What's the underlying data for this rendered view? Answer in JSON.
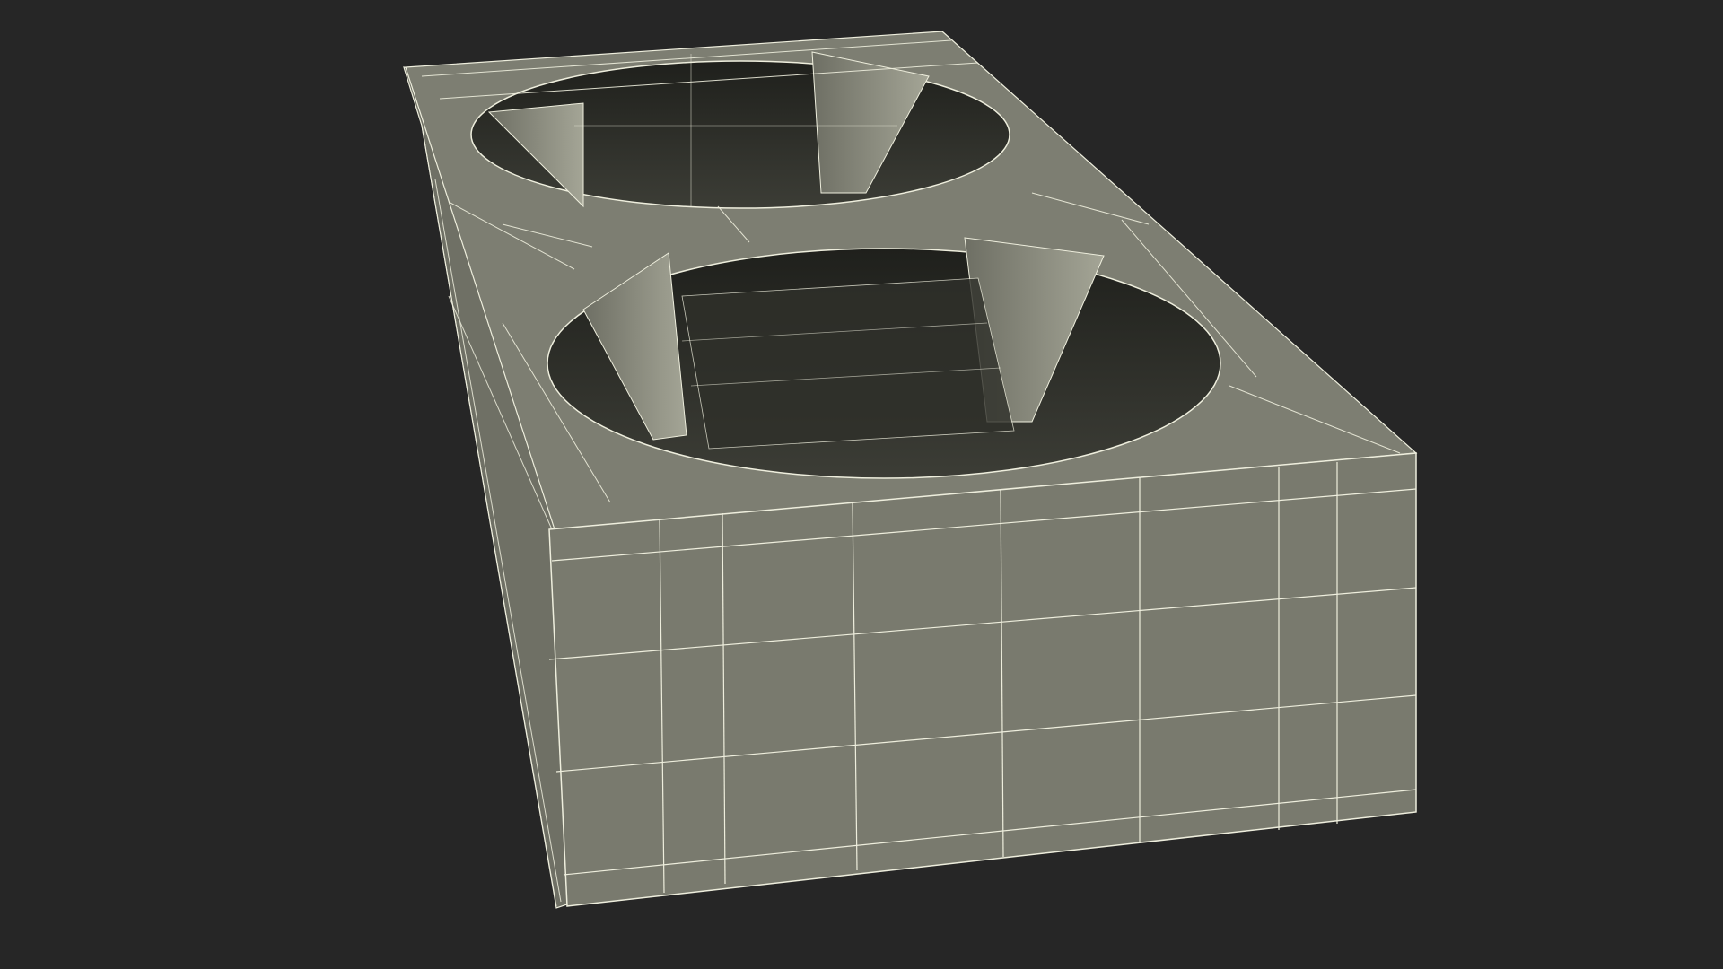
{
  "scene": {
    "subject": "cup holder",
    "render_mode": "wireframe-on-shaded",
    "cup_holes": 2
  },
  "colors": {
    "background": "#262626",
    "surface_light": "#7b7c70",
    "surface_side": "#747569",
    "surface_dark": "#2c2d28",
    "cavity": "#34352f",
    "wire": "#eeeedd"
  }
}
